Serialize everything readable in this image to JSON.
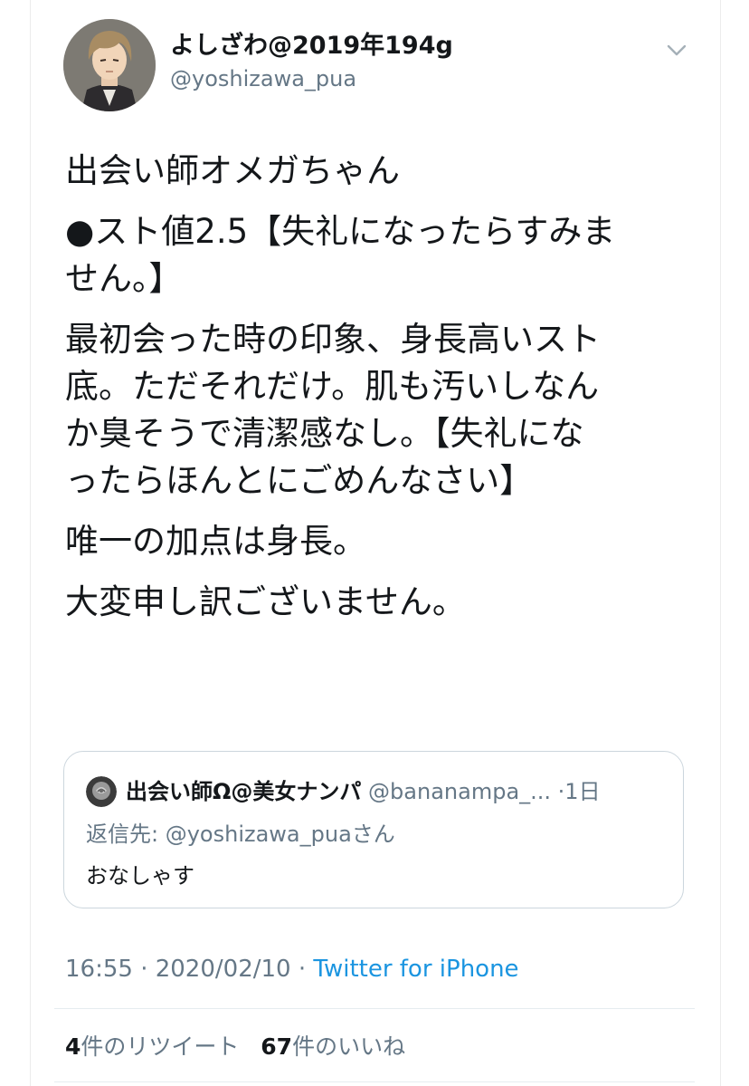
{
  "author": {
    "display_name": "よしざわ@2019年194g",
    "screen_name": "@yoshizawa_pua",
    "avatar_icon": "user-avatar-anime-icon"
  },
  "tweet": {
    "paragraphs": [
      "出会い師オメガちゃん",
      "●スト値2.5【失礼になったらすみま\nせん。】",
      "最初会った時の印象、身長高いスト\n底。ただそれだけ。肌も汚いしなん\nか臭そうで清潔感なし。【失礼にな\nったらほんとにごめんなさい】",
      "唯一の加点は身長。",
      "大変申し訳ございません。"
    ]
  },
  "quoted_tweet": {
    "name": "出会い師Ω@美女ナンパ",
    "handle": "@bananampa_...",
    "time": "·1日",
    "reply_to": "返信先: @yoshizawa_puaさん",
    "text": "おなしゃす",
    "avatar_icon": "rose-avatar-icon"
  },
  "meta": {
    "time": "16:55 · 2020/02/10 · ",
    "source": "Twitter for iPhone"
  },
  "stats": {
    "retweets_count": "4",
    "retweets_label": "件のリツイート",
    "likes_count": "67",
    "likes_label": "件のいいね"
  },
  "colors": {
    "text": "#14171a",
    "secondary": "#657786",
    "link": "#1b95e0",
    "border": "#ccd6dd"
  }
}
